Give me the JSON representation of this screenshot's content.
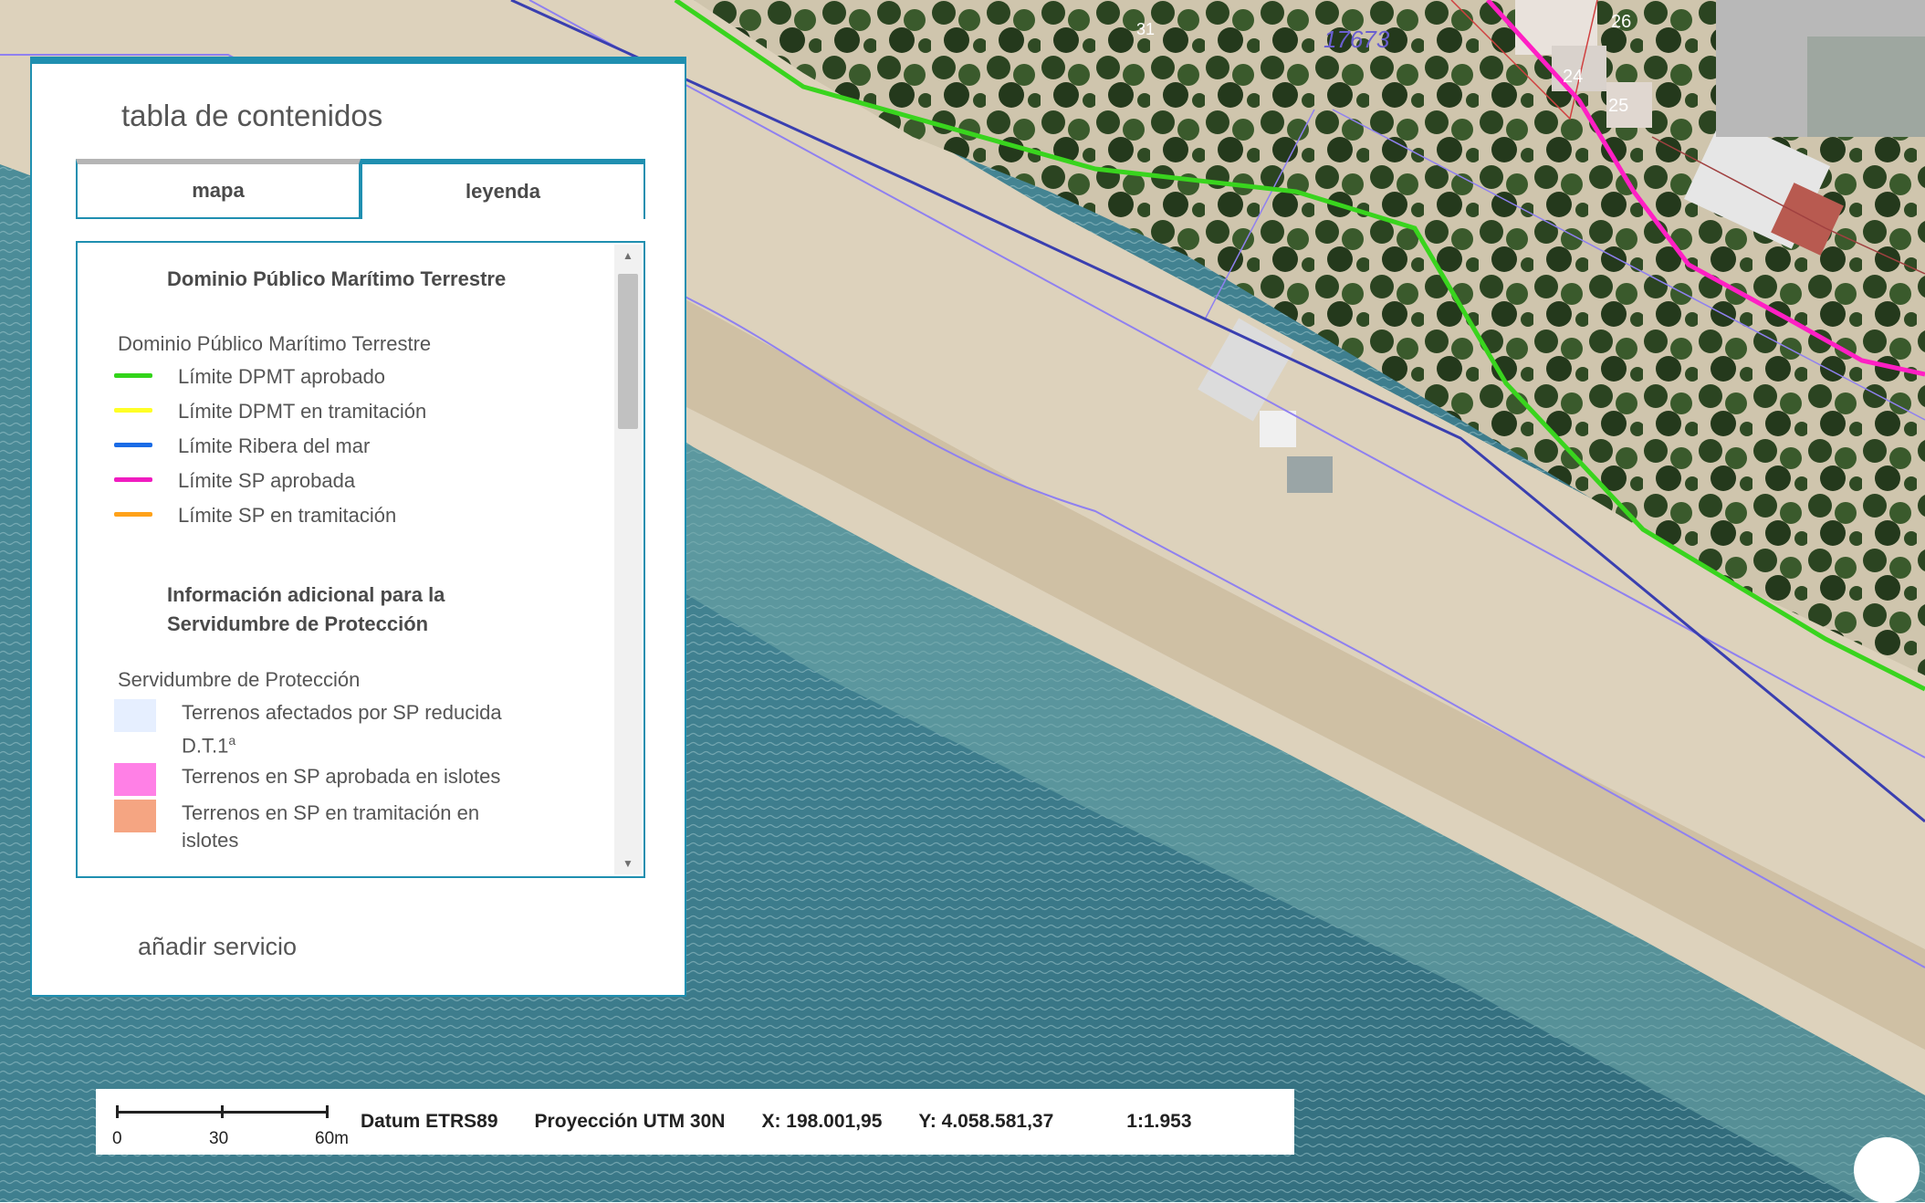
{
  "map": {
    "parcel_labels": [
      "17673",
      "24",
      "25",
      "26",
      "31"
    ],
    "colors": {
      "sea": "#3f7f8f",
      "sand": "#ddd2bc",
      "vegetation": "#2f4a24",
      "dpmt_line": "#39d41e",
      "sp_line": "#ff1fc4",
      "ribera_line": "#3a3fb0",
      "thin_line": "#8f80f0"
    }
  },
  "toc": {
    "title": "tabla de contenidos",
    "tabs": [
      {
        "label": "mapa"
      },
      {
        "label": "leyenda"
      }
    ],
    "legend": {
      "heading_1": "Dominio Público Marítimo Terrestre",
      "group_1": "Dominio Público Marítimo Terrestre",
      "line_items": [
        {
          "label": "Límite DPMT aprobado",
          "color": "#33d41a"
        },
        {
          "label": "Límite DPMT en tramitación",
          "color": "#ffff26"
        },
        {
          "label": "Límite Ribera del mar",
          "color": "#1a6be6"
        },
        {
          "label": "Límite SP aprobada",
          "color": "#f01cc0"
        },
        {
          "label": "Límite SP en tramitación",
          "color": "#ffa21a"
        }
      ],
      "heading_2": "Información adicional para la Servidumbre de Protección",
      "group_2": "Servidumbre de Protección",
      "fill_items": [
        {
          "label": "Terrenos afectados por SP reducida",
          "label_line2": "D.T.1",
          "sup": "a",
          "color": "#e6efff"
        },
        {
          "label": "Terrenos en SP aprobada en islotes",
          "color": "#ff80e6"
        },
        {
          "label": "Terrenos en SP en tramitación en islotes",
          "color": "#f5a582"
        }
      ]
    },
    "add_service": "añadir servicio"
  },
  "infobar": {
    "scale_ticks": [
      "0",
      "30",
      "60m"
    ],
    "datum": "Datum ETRS89",
    "projection": "Proyección UTM 30N",
    "x": "X: 198.001,95",
    "y": "Y: 4.058.581,37",
    "scale": "1:1.953"
  }
}
